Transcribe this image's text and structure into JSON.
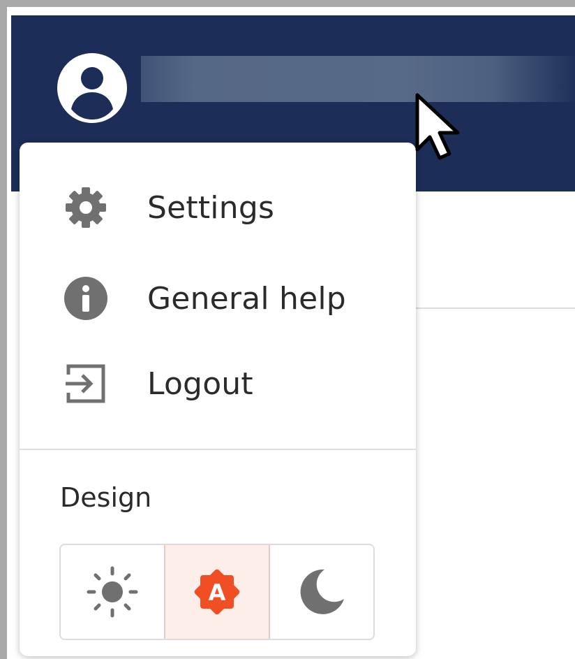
{
  "header": {
    "avatar_icon": "user-circle-icon",
    "colors": {
      "header_bg": "#1c2e57"
    }
  },
  "menu": {
    "items": [
      {
        "icon": "gear-icon",
        "label": "Settings"
      },
      {
        "icon": "info-icon",
        "label": "General help"
      },
      {
        "icon": "logout-icon",
        "label": "Logout"
      }
    ],
    "design": {
      "label": "Design",
      "options": [
        {
          "icon": "sun-icon",
          "value": "light",
          "selected": false
        },
        {
          "icon": "auto-theme-icon",
          "value": "auto",
          "selected": true,
          "badge": "A"
        },
        {
          "icon": "moon-icon",
          "value": "dark",
          "selected": false
        }
      ]
    },
    "colors": {
      "icon": "#707070",
      "accent": "#f04e23",
      "selected_bg": "#fdeeea"
    }
  }
}
